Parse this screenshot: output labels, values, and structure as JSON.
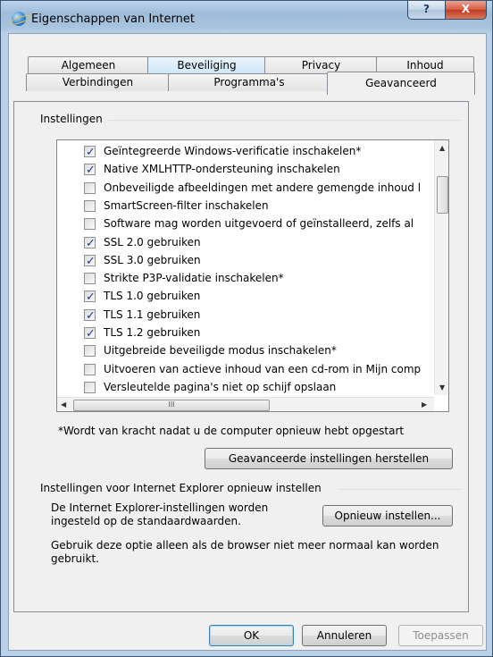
{
  "window": {
    "title": "Eigenschappen van Internet",
    "help_glyph": "?",
    "close_glyph": "X"
  },
  "tabs_row1": [
    {
      "label": "Algemeen"
    },
    {
      "label": "Beveiliging"
    },
    {
      "label": "Privacy"
    },
    {
      "label": "Inhoud"
    }
  ],
  "tabs_row2": [
    {
      "label": "Verbindingen"
    },
    {
      "label": "Programma's"
    },
    {
      "label": "Geavanceerd",
      "selected": true
    }
  ],
  "settings": {
    "group_label": "Instellingen",
    "items": [
      {
        "label": "Geïntegreerde Windows-verificatie inschakelen*",
        "checked": true
      },
      {
        "label": "Native XMLHTTP-ondersteuning inschakelen",
        "checked": true
      },
      {
        "label": "Onbeveiligde afbeeldingen met andere gemengde inhoud l",
        "checked": false
      },
      {
        "label": "SmartScreen-filter inschakelen",
        "checked": false
      },
      {
        "label": "Software mag worden uitgevoerd of geïnstalleerd, zelfs al",
        "checked": false
      },
      {
        "label": "SSL 2.0 gebruiken",
        "checked": true
      },
      {
        "label": "SSL 3.0 gebruiken",
        "checked": true
      },
      {
        "label": "Strikte P3P-validatie inschakelen*",
        "checked": false
      },
      {
        "label": "TLS 1.0 gebruiken",
        "checked": true
      },
      {
        "label": "TLS 1.1 gebruiken",
        "checked": true
      },
      {
        "label": "TLS 1.2 gebruiken",
        "checked": true
      },
      {
        "label": "Uitgebreide beveiligde modus inschakelen*",
        "checked": false
      },
      {
        "label": "Uitvoeren van actieve inhoud van een cd-rom in Mijn comp",
        "checked": false
      },
      {
        "label": "Versleutelde pagina's niet op schijf opslaan",
        "checked": false
      }
    ],
    "scroll_thumb_glyph": "III",
    "restart_note": "*Wordt van kracht nadat u de computer opnieuw hebt opgestart",
    "restore_button": "Geavanceerde instellingen herstellen"
  },
  "reset": {
    "group_label": "Instellingen voor Internet Explorer opnieuw instellen",
    "description": "De Internet Explorer-instellingen worden ingesteld op de standaardwaarden.",
    "button": "Opnieuw instellen...",
    "note": "Gebruik deze optie alleen als de browser niet meer normaal kan worden gebruikt."
  },
  "footer": {
    "ok": "OK",
    "cancel": "Annuleren",
    "apply": "Toepassen"
  }
}
